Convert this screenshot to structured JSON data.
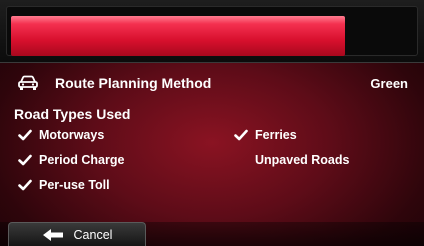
{
  "progress": {
    "value": 0.83
  },
  "route_method": {
    "icon": "car-icon",
    "label": "Route Planning Method",
    "value": "Green"
  },
  "road_types": {
    "heading": "Road Types Used",
    "items": [
      {
        "label": "Motorways",
        "checked": true
      },
      {
        "label": "Period Charge",
        "checked": true
      },
      {
        "label": "Per-use Toll",
        "checked": true
      },
      {
        "label": "Ferries",
        "checked": true
      },
      {
        "label": "Unpaved Roads",
        "checked": false
      }
    ]
  },
  "footer": {
    "cancel_label": "Cancel",
    "cancel_icon": "arrow-left-icon"
  },
  "colors": {
    "accent_bar": "#e01a38",
    "background": "#6b0f1c"
  }
}
